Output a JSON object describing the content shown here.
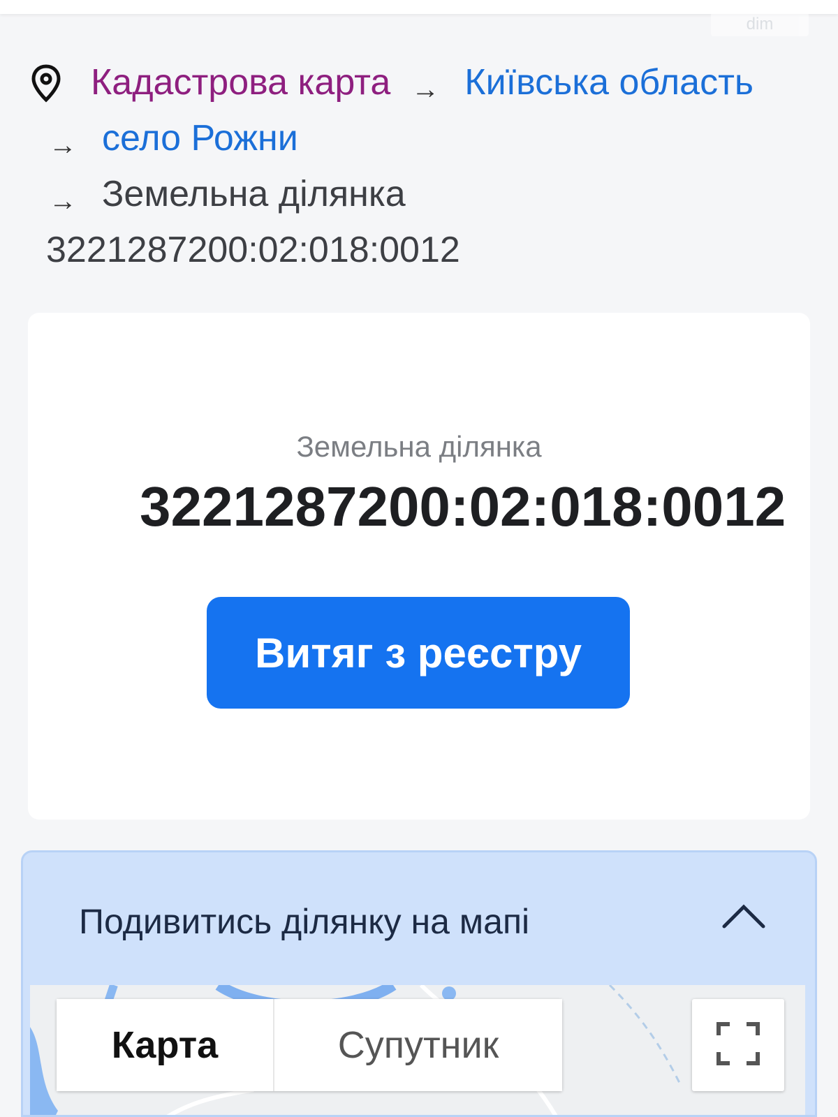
{
  "watermark": "dim",
  "breadcrumb": {
    "items": [
      {
        "label": "Кадастрова карта"
      },
      {
        "label": "Київська область"
      },
      {
        "label": "село Рожни"
      },
      {
        "label": "Земельна ділянка 3221287200:02:018:0012"
      }
    ],
    "separator": "→",
    "last_line_1": "Земельна ділянка",
    "last_line_2": "3221287200:02:018:0012"
  },
  "card": {
    "label": "Земельна ділянка",
    "cadastral_number": "3221287200:02:018:0012",
    "button_label": "Витяг з реєстру"
  },
  "map_section": {
    "title": "Подивитись ділянку на мапі",
    "tabs": [
      {
        "label": "Карта",
        "selected": true
      },
      {
        "label": "Супутник",
        "selected": false
      }
    ]
  },
  "colors": {
    "breadcrumb_root": "#8e1f7f",
    "breadcrumb_link": "#1b6fd8",
    "primary_button": "#1573f0",
    "map_header_bg": "#cfe1fb"
  },
  "icons": [
    "map-pin-icon",
    "chevron-up-icon",
    "fullscreen-icon"
  ]
}
